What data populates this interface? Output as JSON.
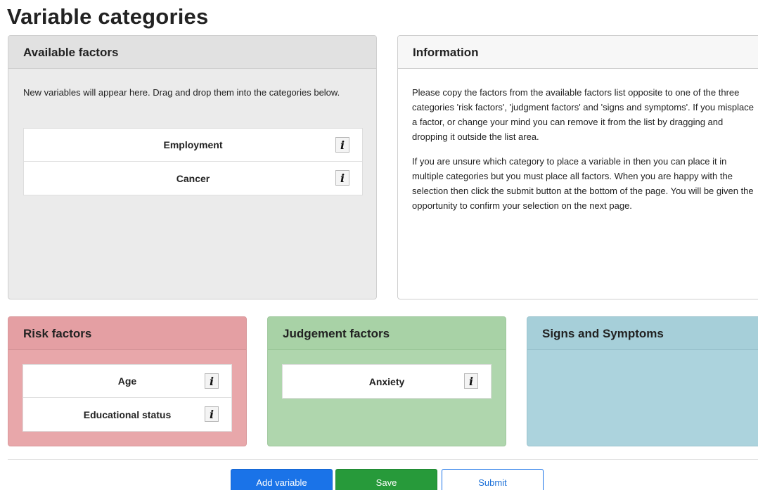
{
  "page": {
    "title": "Variable categories"
  },
  "available": {
    "title": "Available factors",
    "description": "New variables will appear here. Drag and drop them into the categories below.",
    "items": [
      {
        "label": "Employment"
      },
      {
        "label": "Cancer"
      }
    ]
  },
  "information": {
    "title": "Information",
    "paragraph1": "Please copy the factors from the available factors list opposite to one of the three categories 'risk factors', 'judgment factors' and 'signs and symptoms'. If you misplace a factor, or change your mind you can remove it from the list by dragging and dropping it outside the list area.",
    "paragraph2": "If you are unsure which category to place a variable in then you can place it in multiple categories but you must place all factors. When you are happy with the selection then click the submit button at the bottom of the page. You will be given the opportunity to confirm your selection on the next page."
  },
  "risk": {
    "title": "Risk factors",
    "items": [
      {
        "label": "Age"
      },
      {
        "label": "Educational status"
      }
    ]
  },
  "judgement": {
    "title": "Judgement factors",
    "items": [
      {
        "label": "Anxiety"
      }
    ]
  },
  "signs": {
    "title": "Signs and Symptoms",
    "items": []
  },
  "buttons": {
    "add_variable": "Add variable",
    "save": "Save",
    "submit": "Submit"
  },
  "icons": {
    "info": "info-icon",
    "info_glyph": "i"
  },
  "colors": {
    "risk_bg": "#e8a7aa",
    "judgement_bg": "#afd6ad",
    "signs_bg": "#acd3dd",
    "primary": "#1a73e8",
    "success": "#279a3a"
  }
}
